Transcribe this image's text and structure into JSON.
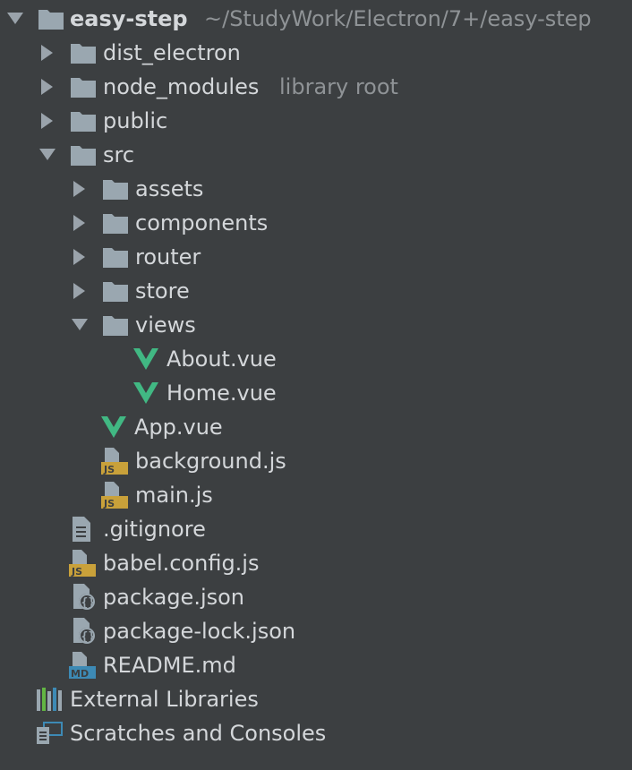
{
  "project": {
    "name": "easy-step",
    "path": "~/StudyWork/Electron/7+/easy-step"
  },
  "items": {
    "dist_electron": "dist_electron",
    "node_modules": "node_modules",
    "node_modules_hint": "library root",
    "public": "public",
    "src": "src",
    "assets": "assets",
    "components": "components",
    "router": "router",
    "store": "store",
    "views": "views",
    "about_vue": "About.vue",
    "home_vue": "Home.vue",
    "app_vue": "App.vue",
    "background_js": "background.js",
    "main_js": "main.js",
    "gitignore": ".gitignore",
    "babel_config": "babel.config.js",
    "package_json": "package.json",
    "package_lock": "package-lock.json",
    "readme": "README.md",
    "external_libraries": "External Libraries",
    "scratches": "Scratches and Consoles"
  },
  "badges": {
    "js": "JS",
    "md": "MD"
  },
  "colors": {
    "background": "#3c3f41",
    "text": "#d4d7da",
    "hint": "#8f9396",
    "folder": "#9aa7b0",
    "vue": "#41b883",
    "js_badge": "#c9a13a",
    "md_badge": "#3d8ab5"
  },
  "icons": {
    "collapsed": "triangle-right-icon",
    "expanded": "triangle-down-icon",
    "folder": "folder-icon",
    "vue": "vue-icon",
    "js": "js-file-icon",
    "text": "text-file-icon",
    "json": "json-file-icon",
    "md": "markdown-file-icon",
    "libraries": "library-icon",
    "scratches": "scratches-icon"
  }
}
